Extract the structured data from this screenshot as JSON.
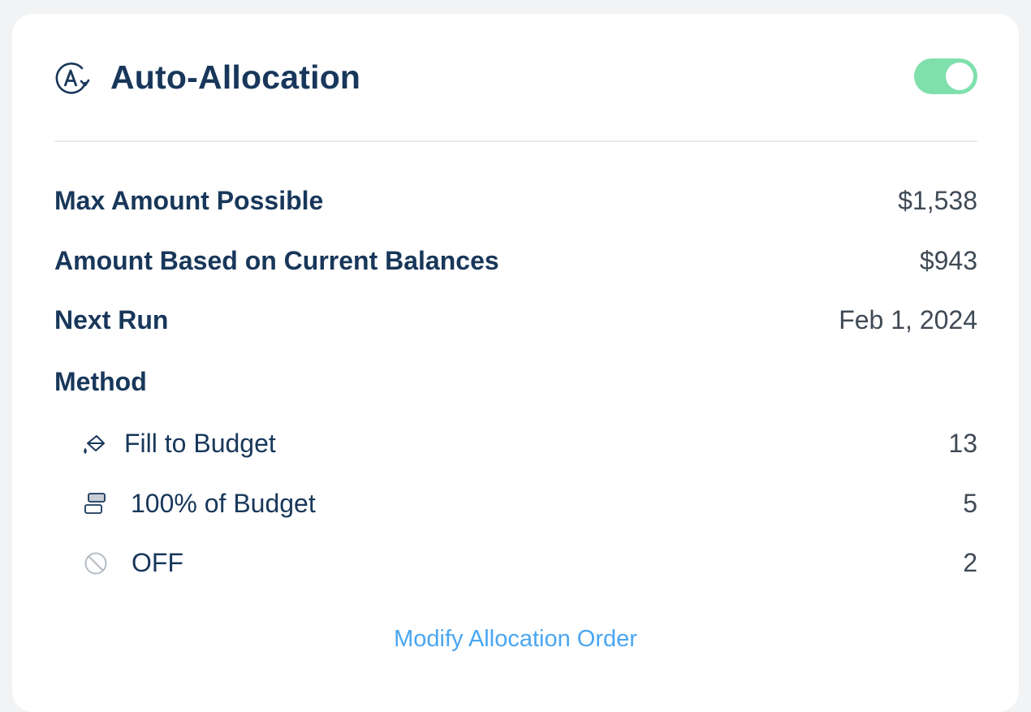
{
  "header": {
    "title": "Auto-Allocation",
    "icon": "auto-allocation-icon",
    "toggle_on": true,
    "toggle_color": "#7fe0ac"
  },
  "summary": {
    "max_amount_label": "Max Amount Possible",
    "max_amount_value": "$1,538",
    "current_amount_label": "Amount Based on Current Balances",
    "current_amount_value": "$943",
    "next_run_label": "Next Run",
    "next_run_value": "Feb 1, 2024"
  },
  "method": {
    "heading": "Method",
    "items": [
      {
        "label": "Fill to Budget",
        "count": "13",
        "icon": "paint-bucket-icon"
      },
      {
        "label": "100% of Budget",
        "count": "5",
        "icon": "budget-bars-icon"
      },
      {
        "label": "OFF",
        "count": "2",
        "icon": "prohibited-icon"
      }
    ]
  },
  "footer": {
    "link_label": "Modify Allocation Order",
    "link_color": "#4aa6f1"
  }
}
